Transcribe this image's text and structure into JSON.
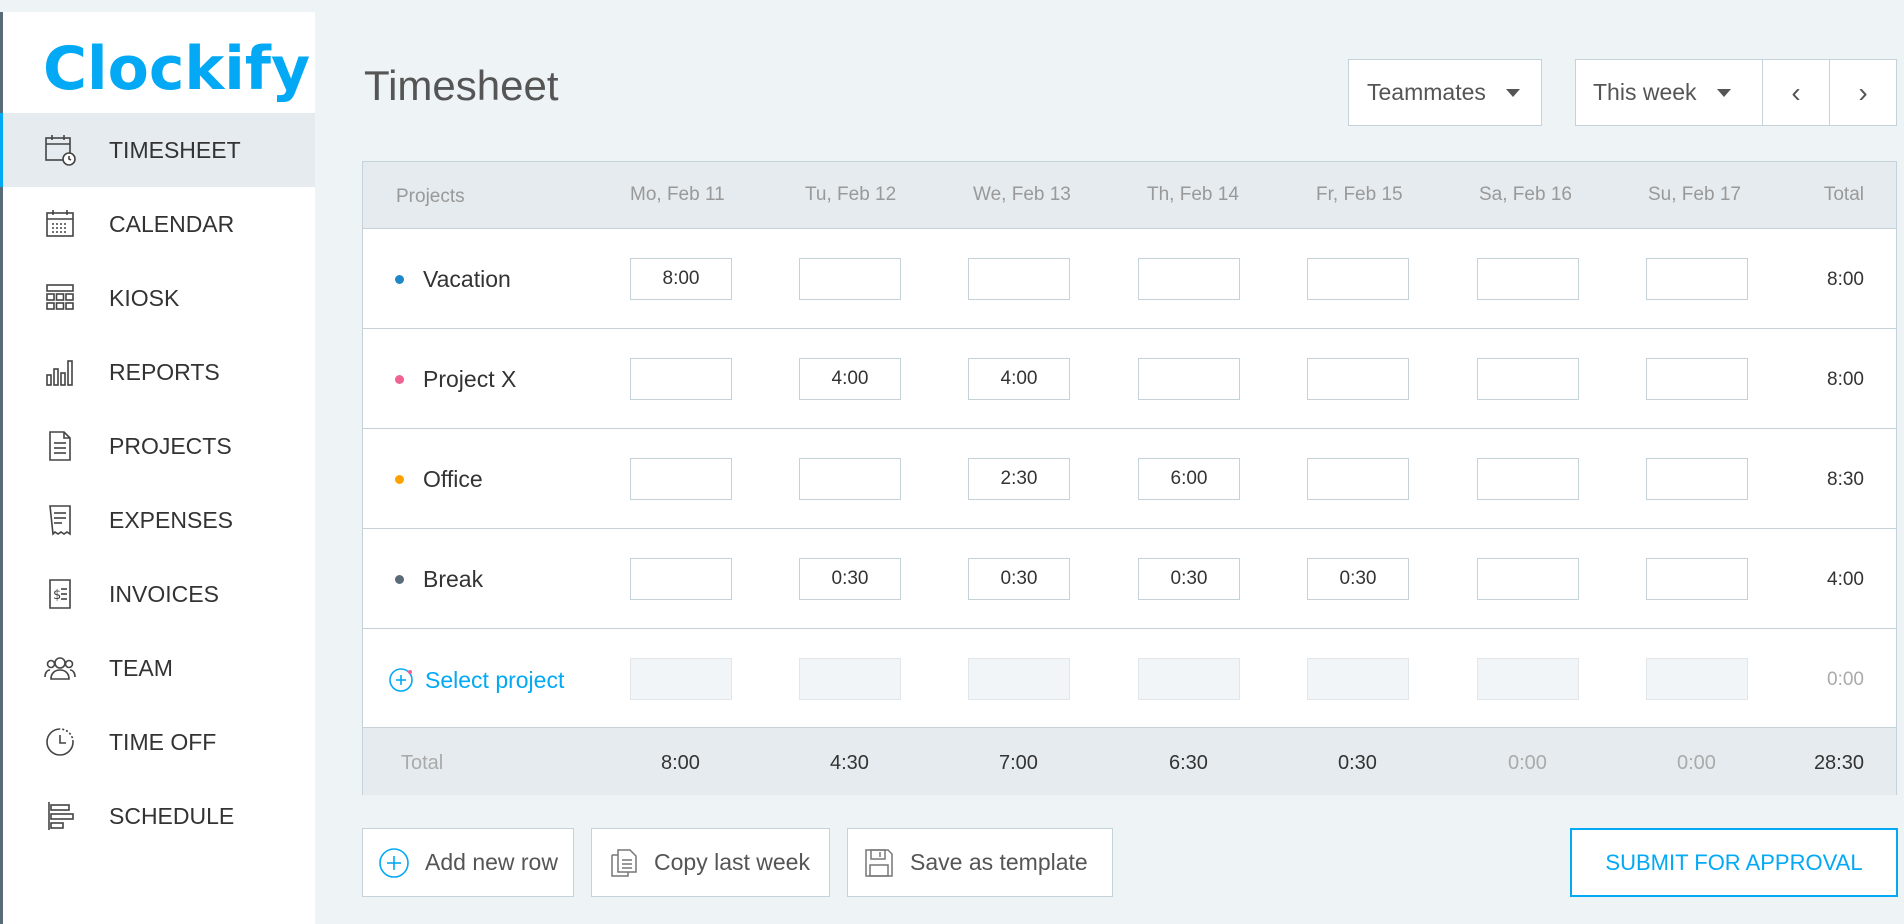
{
  "app": {
    "logo_text": "lockify",
    "logo_letter": "C"
  },
  "sidebar": {
    "items": [
      {
        "label": "TIMESHEET",
        "icon": "timesheet-icon",
        "active": true
      },
      {
        "label": "CALENDAR",
        "icon": "calendar-icon"
      },
      {
        "label": "KIOSK",
        "icon": "kiosk-icon"
      },
      {
        "label": "REPORTS",
        "icon": "reports-icon"
      },
      {
        "label": "PROJECTS",
        "icon": "projects-icon"
      },
      {
        "label": "EXPENSES",
        "icon": "expenses-icon"
      },
      {
        "label": "INVOICES",
        "icon": "invoices-icon"
      },
      {
        "label": "TEAM",
        "icon": "team-icon"
      },
      {
        "label": "TIME OFF",
        "icon": "time-off-icon"
      },
      {
        "label": "SCHEDULE",
        "icon": "schedule-icon"
      }
    ]
  },
  "header": {
    "title": "Timesheet",
    "teammates_label": "Teammates",
    "week_label": "This week",
    "prev_label": "‹",
    "next_label": "›"
  },
  "table": {
    "columns": [
      "Projects",
      "Mo, Feb 11",
      "Tu, Feb 12",
      "We, Feb 13",
      "Th, Feb 14",
      "Fr, Feb 15",
      "Sa, Feb 16",
      "Su, Feb 17",
      "Total"
    ],
    "rows": [
      {
        "project": "Vacation",
        "color": "#1e88c7",
        "cells": [
          "8:00",
          "",
          "",
          "",
          "",
          "",
          ""
        ],
        "total": "8:00"
      },
      {
        "project": "Project X",
        "color": "#f06292",
        "cells": [
          "",
          "4:00",
          "4:00",
          "",
          "",
          "",
          ""
        ],
        "total": "8:00"
      },
      {
        "project": "Office",
        "color": "#ffa000",
        "cells": [
          "",
          "",
          "2:30",
          "6:00",
          "",
          "",
          ""
        ],
        "total": "8:30"
      },
      {
        "project": "Break",
        "color": "#5a6b78",
        "cells": [
          "",
          "0:30",
          "0:30",
          "0:30",
          "0:30",
          "",
          ""
        ],
        "total": "4:00"
      }
    ],
    "select_project": {
      "label": "Select project",
      "total": "0:00"
    },
    "footer": {
      "label": "Total",
      "values": [
        "8:00",
        "4:30",
        "7:00",
        "6:30",
        "0:30",
        "0:00",
        "0:00"
      ],
      "grand_total": "28:30"
    }
  },
  "actions": {
    "add_row": "Add new row",
    "copy_week": "Copy last week",
    "save_template": "Save as template",
    "submit": "SUBMIT FOR APPROVAL"
  },
  "colors": {
    "accent": "#03a9f4",
    "border": "#c6d2d9",
    "header_bg": "#e5ebef"
  }
}
